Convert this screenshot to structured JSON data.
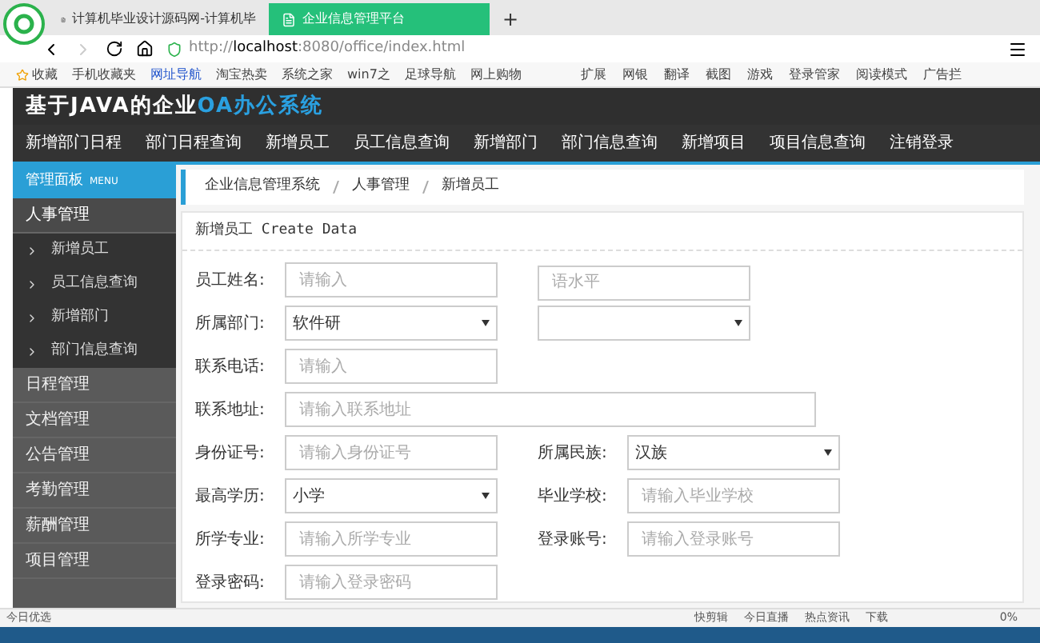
{
  "browser": {
    "tabs": [
      {
        "label": "计算机毕业设计源码网-计算机毕",
        "selected": false
      },
      {
        "label": "企业信息管理平台",
        "selected": true
      }
    ],
    "new_tab": "+",
    "url": {
      "scheme": "http://",
      "host": "localhost",
      "rest": ":8080/office/index.html"
    },
    "bookmarks": [
      "收藏",
      "手机收藏夹",
      "网址导航",
      "淘宝热卖",
      "系统之家",
      "win7之",
      "足球导航",
      "网上购物"
    ],
    "tools": [
      "扩展",
      "网银",
      "翻译",
      "截图",
      "游戏",
      "登录管家",
      "阅读模式",
      "广告拦"
    ]
  },
  "header": {
    "title_plain": "基于JAVA的企业",
    "title_accent": "OA办公系统"
  },
  "nav": [
    "新增部门日程",
    "部门日程查询",
    "新增员工",
    "员工信息查询",
    "新增部门",
    "部门信息查询",
    "新增项目",
    "项目信息查询",
    "注销登录"
  ],
  "sidebar": {
    "panel_title": "管理面板",
    "panel_badge": "MENU",
    "items": [
      {
        "label": "人事管理",
        "expanded": true,
        "children": [
          {
            "label": "新增员工"
          },
          {
            "label": "员工信息查询"
          },
          {
            "label": "新增部门"
          },
          {
            "label": "部门信息查询"
          }
        ]
      },
      {
        "label": "日程管理",
        "expanded": false
      },
      {
        "label": "文档管理",
        "expanded": false
      },
      {
        "label": "公告管理",
        "expanded": false
      },
      {
        "label": "考勤管理",
        "expanded": false
      },
      {
        "label": "薪酬管理",
        "expanded": false
      },
      {
        "label": "项目管理",
        "expanded": false
      }
    ]
  },
  "breadcrumb": [
    "企业信息管理系统",
    "人事管理",
    "新增员工"
  ],
  "form": {
    "title": "新增员工 Create Data",
    "rows": [
      {
        "left": {
          "label": "员工姓名:",
          "kind": "input",
          "placeholder": "请输入"
        },
        "right": {
          "kind": "input",
          "placeholder": "语水平"
        }
      },
      {
        "left": {
          "label": "所属部门:",
          "kind": "select",
          "value": "软件研"
        },
        "right": {
          "kind": "select"
        }
      },
      {
        "left": {
          "label": "联系电话:",
          "kind": "input",
          "placeholder": "请输入"
        }
      },
      {
        "left": {
          "label": "联系地址:",
          "kind": "wide",
          "placeholder": "请输入联系地址"
        }
      },
      {
        "left": {
          "label": "身份证号:",
          "kind": "input",
          "placeholder": "请输入身份证号"
        },
        "right": {
          "label": "所属民族:",
          "kind": "select",
          "value": "汉族"
        }
      },
      {
        "left": {
          "label": "最高学历:",
          "kind": "select",
          "value": "小学"
        },
        "right": {
          "label": "毕业学校:",
          "kind": "input",
          "placeholder": "请输入毕业学校"
        }
      },
      {
        "left": {
          "label": "所学专业:",
          "kind": "input",
          "placeholder": "请输入所学专业"
        },
        "right": {
          "label": "登录账号:",
          "kind": "input",
          "placeholder": "请输入登录账号"
        }
      },
      {
        "left": {
          "label": "登录密码:",
          "kind": "input",
          "placeholder": "请输入登录密码"
        }
      }
    ]
  },
  "status_bar": {
    "left": "今日优选",
    "items": [
      "快剪辑",
      "今日直播",
      "热点资讯",
      "下载"
    ],
    "zoom": "0%"
  }
}
